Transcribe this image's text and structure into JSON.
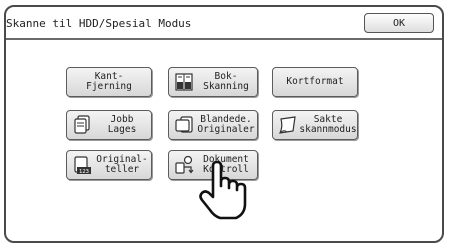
{
  "window": {
    "title": "Skanne til HDD/Spesial Modus",
    "ok_label": "OK"
  },
  "buttons": {
    "edge_erase": "Kant-\nFjerning",
    "book_scan": "Bok-\nSkanning",
    "card_format": "Kortformat",
    "job_build": "Jobb\nLages",
    "mixed_originals": "Blandede.\nOriginaler",
    "slow_scan": "Sakte\nskannmodus",
    "original_counter": "Original-\nteller",
    "document_control": "Dokument\nKontroll"
  },
  "icons": {
    "book_scan": "book-scan-icon",
    "job_build": "stacked-pages-icon",
    "mixed_originals": "mixed-pages-icon",
    "slow_scan": "curled-page-icon",
    "original_counter": "counter-icon",
    "document_control": "document-control-icon",
    "pointer": "hand-pointer-icon"
  }
}
